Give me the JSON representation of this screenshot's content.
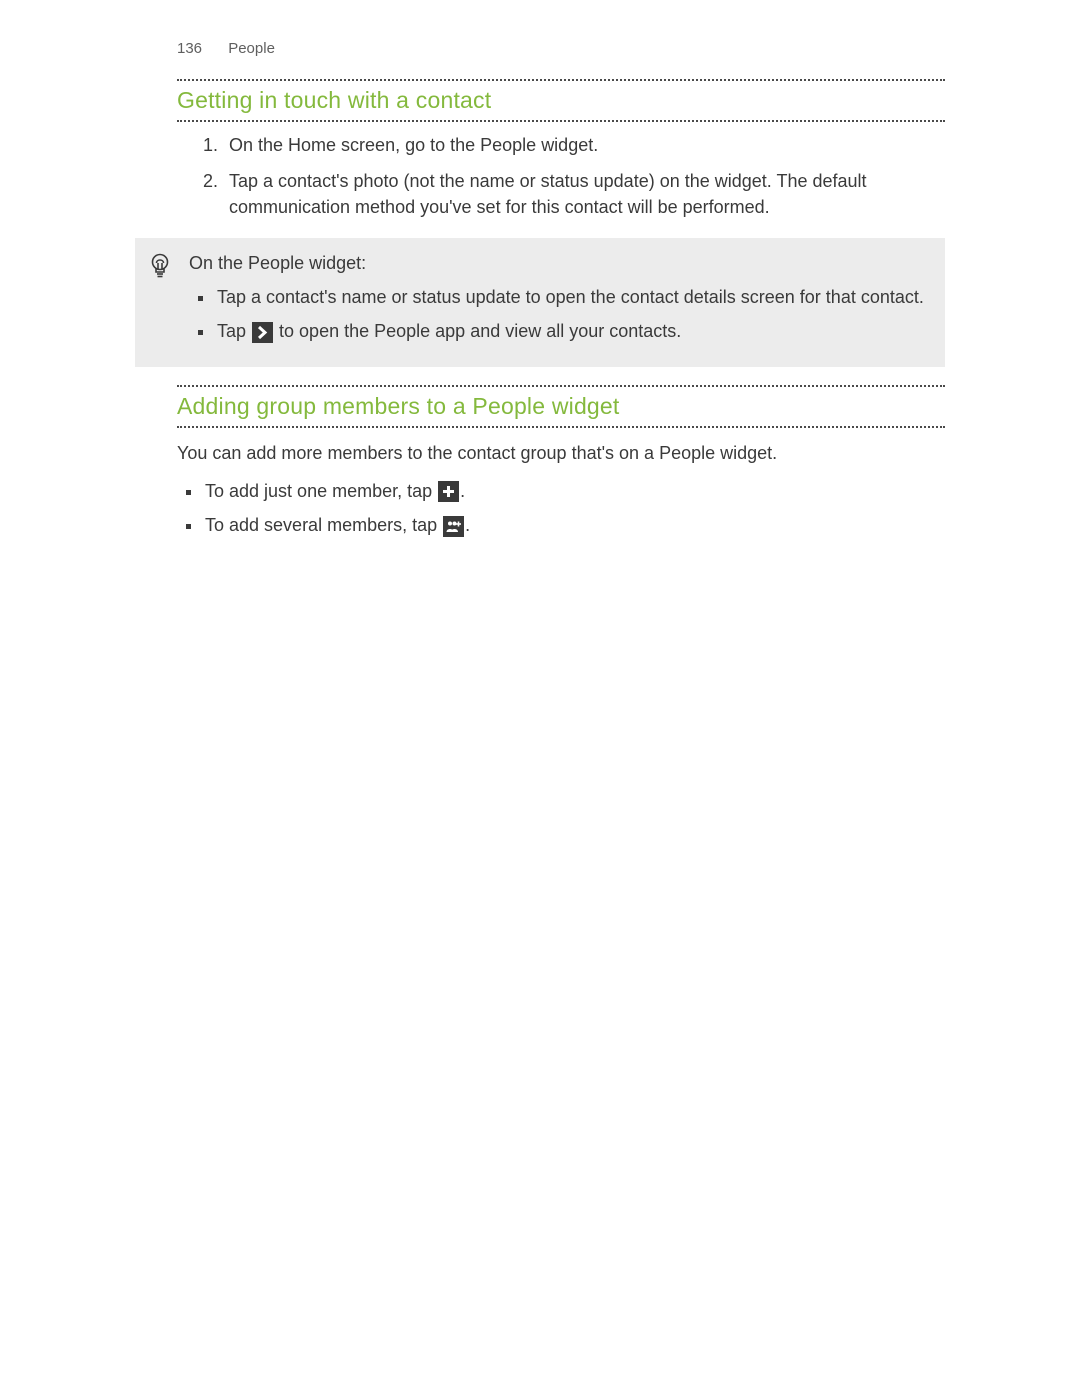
{
  "accent": "#84b93d",
  "header": {
    "page_number": "136",
    "chapter": "People"
  },
  "section1": {
    "title": "Getting in touch with a contact",
    "steps": [
      "On the Home screen, go to the People widget.",
      "Tap a contact's photo (not the name or status update) on the widget. The default communication method you've set for this contact will be performed."
    ]
  },
  "tip": {
    "icon_name": "lightbulb-icon",
    "intro": "On the People widget:",
    "items": {
      "b1": "Tap a contact's name or status update to open the contact details screen for that contact.",
      "b2_before": "Tap ",
      "b2_after": " to open the People app and view all your contacts."
    }
  },
  "section2": {
    "title": "Adding group members to a People widget",
    "intro": "You can add more members to the contact group that's on a People widget.",
    "items": {
      "i1_before": "To add just one member, tap ",
      "i1_after": ".",
      "i2_before": "To add several members, tap ",
      "i2_after": "."
    }
  }
}
